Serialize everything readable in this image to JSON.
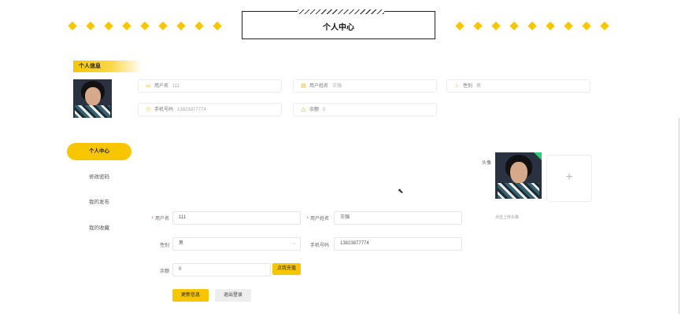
{
  "header": {
    "title": "个人中心"
  },
  "profile_tag": "个人信息",
  "info": {
    "username_label": "用户名",
    "username_value": "111",
    "realname_label": "用户姓名",
    "realname_value": "王强",
    "gender_label": "性别",
    "gender_value": "男",
    "phone_label": "手机号码",
    "phone_value": "13823877774",
    "balance_label": "余额",
    "balance_value": "0"
  },
  "nav": [
    "个人中心",
    "修改密码",
    "我的发布",
    "我的收藏"
  ],
  "form": {
    "avatar_label": "头像",
    "upload_hint": "点击上传头像",
    "upload_plus": "+",
    "username_label": "用户名",
    "username_value": "111",
    "realname_label": "用户姓名",
    "realname_value": "王强",
    "gender_label": "性别",
    "gender_value": "男",
    "phone_label": "手机号码",
    "phone_value": "13823877774",
    "balance_label": "余额",
    "balance_value": "0",
    "recharge_button": "点我充值",
    "update_button": "更新信息",
    "logout_button": "退出登录"
  },
  "colors": {
    "accent": "#f7c600",
    "upload_badge": "#2ecc71"
  },
  "icons": {
    "username": "id-card-icon",
    "realname": "document-icon",
    "gender": "home-icon",
    "phone": "users-icon",
    "balance": "warning-triangle-icon"
  }
}
